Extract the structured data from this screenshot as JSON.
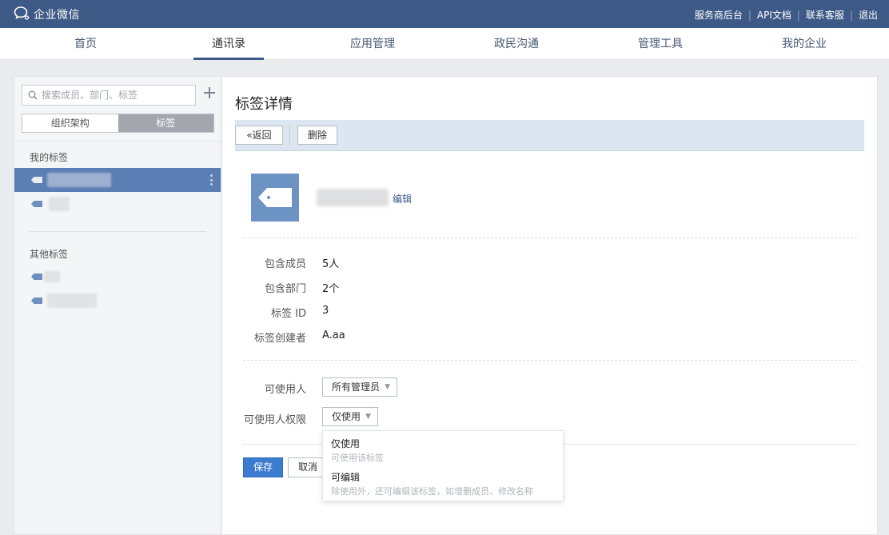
{
  "topbar": {
    "brand": "企业微信",
    "links": [
      "服务商后台",
      "API文档",
      "联系客服",
      "退出"
    ]
  },
  "nav": {
    "items": [
      "首页",
      "通讯录",
      "应用管理",
      "政民沟通",
      "管理工具",
      "我的企业"
    ],
    "active": "通讯录"
  },
  "sidebar": {
    "search_placeholder": "搜索成员、部门、标签",
    "segments": [
      "组织架构",
      "标签"
    ],
    "active_segment": "标签",
    "my_tags_label": "我的标签",
    "other_tags_label": "其他标签"
  },
  "main": {
    "title": "标签详情",
    "back_label": "返回",
    "delete_label": "删除",
    "edit_label": "编辑",
    "info": [
      {
        "label": "包含成员",
        "value": "5人"
      },
      {
        "label": "包含部门",
        "value": "2个"
      },
      {
        "label": "标签 ID",
        "value": "3"
      },
      {
        "label": "标签创建者",
        "value": "A.aa"
      }
    ],
    "users_label": "可使用人",
    "users_value": "所有管理员",
    "perm_label": "可使用人权限",
    "perm_value": "仅使用",
    "save_label": "保存",
    "cancel_label": "取消"
  },
  "dropdown": {
    "options": [
      {
        "title": "仅使用",
        "desc": "可使用该标签"
      },
      {
        "title": "可编辑",
        "desc": "除使用外，还可编辑该标签，如增删成员、修改名称"
      }
    ]
  },
  "colors": {
    "topbar": "#3d5a86",
    "active_row": "#5b7eb4",
    "toolbar": "#dce6f2",
    "primary_button": "#3b7bd0"
  }
}
